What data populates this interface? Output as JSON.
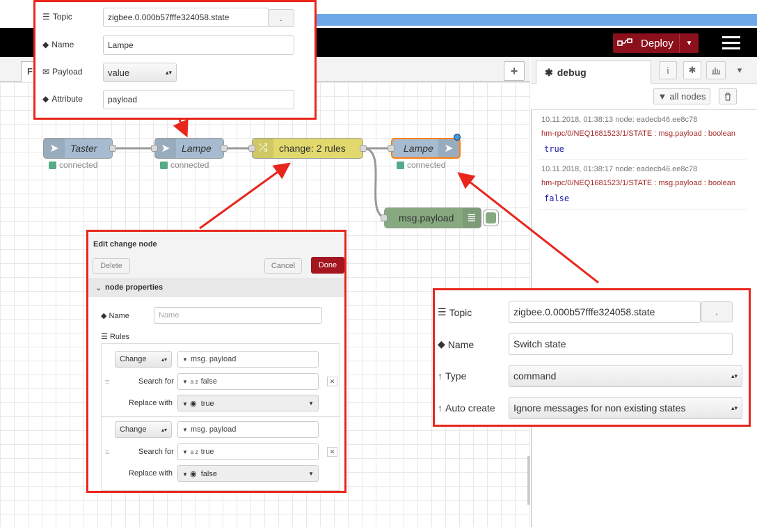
{
  "header": {
    "deploy_label": "Deploy"
  },
  "workspace": {
    "tab_label": "F",
    "add_tab_label": "+"
  },
  "sidebar": {
    "tab_label": "debug",
    "filter_label": "all nodes",
    "messages": [
      {
        "meta": "10.11.2018, 01:38:13    node: eadecb46.ee8c78",
        "path": "hm-rpc/0/NEQ1681523/1/STATE : msg.payload : boolean",
        "value": "true"
      },
      {
        "meta": "10.11.2018, 01:38:17    node: eadecb46.ee8c78",
        "path": "hm-rpc/0/NEQ1681523/1/STATE : msg.payload : boolean",
        "value": "false"
      }
    ]
  },
  "nodes": {
    "taster": {
      "label": "Taster",
      "status": "connected"
    },
    "lampe_in": {
      "label": "Lampe",
      "status": "connected"
    },
    "change": {
      "label": "change: 2 rules"
    },
    "lampe_out": {
      "label": "Lampe",
      "status": "connected"
    },
    "debug": {
      "label": "msg.payload"
    }
  },
  "top_form": {
    "topic_label": "Topic",
    "topic_value": "zigbee.0.000b57fffe324058.state",
    "topic_btn": ".",
    "name_label": "Name",
    "name_value": "Lampe",
    "payload_label": "Payload",
    "payload_value": "value",
    "attribute_label": "Attribute",
    "attribute_value": "payload"
  },
  "right_form": {
    "topic_label": "Topic",
    "topic_value": "zigbee.0.000b57fffe324058.state",
    "topic_btn": ".",
    "name_label": "Name",
    "name_value": "Switch state",
    "type_label": "Type",
    "type_value": "command",
    "autocreate_label": "Auto create",
    "autocreate_value": "Ignore messages for non existing states"
  },
  "change_dialog": {
    "title": "Edit change node",
    "delete_label": "Delete",
    "cancel_label": "Cancel",
    "done_label": "Done",
    "section_label": "node properties",
    "name_label": "Name",
    "name_placeholder": "Name",
    "rules_label": "Rules",
    "rules": [
      {
        "action": "Change",
        "target": "msg. payload",
        "search_label": "Search for",
        "search_type": "a z",
        "search_value": "false",
        "replace_label": "Replace with",
        "replace_value": "true"
      },
      {
        "action": "Change",
        "target": "msg. payload",
        "search_label": "Search for",
        "search_type": "a z",
        "search_value": "true",
        "replace_label": "Replace with",
        "replace_value": "false"
      }
    ]
  },
  "colors": {
    "annotation_red": "#e8261c",
    "deploy_bg": "#8c101c",
    "done_bg": "#a3151f"
  }
}
